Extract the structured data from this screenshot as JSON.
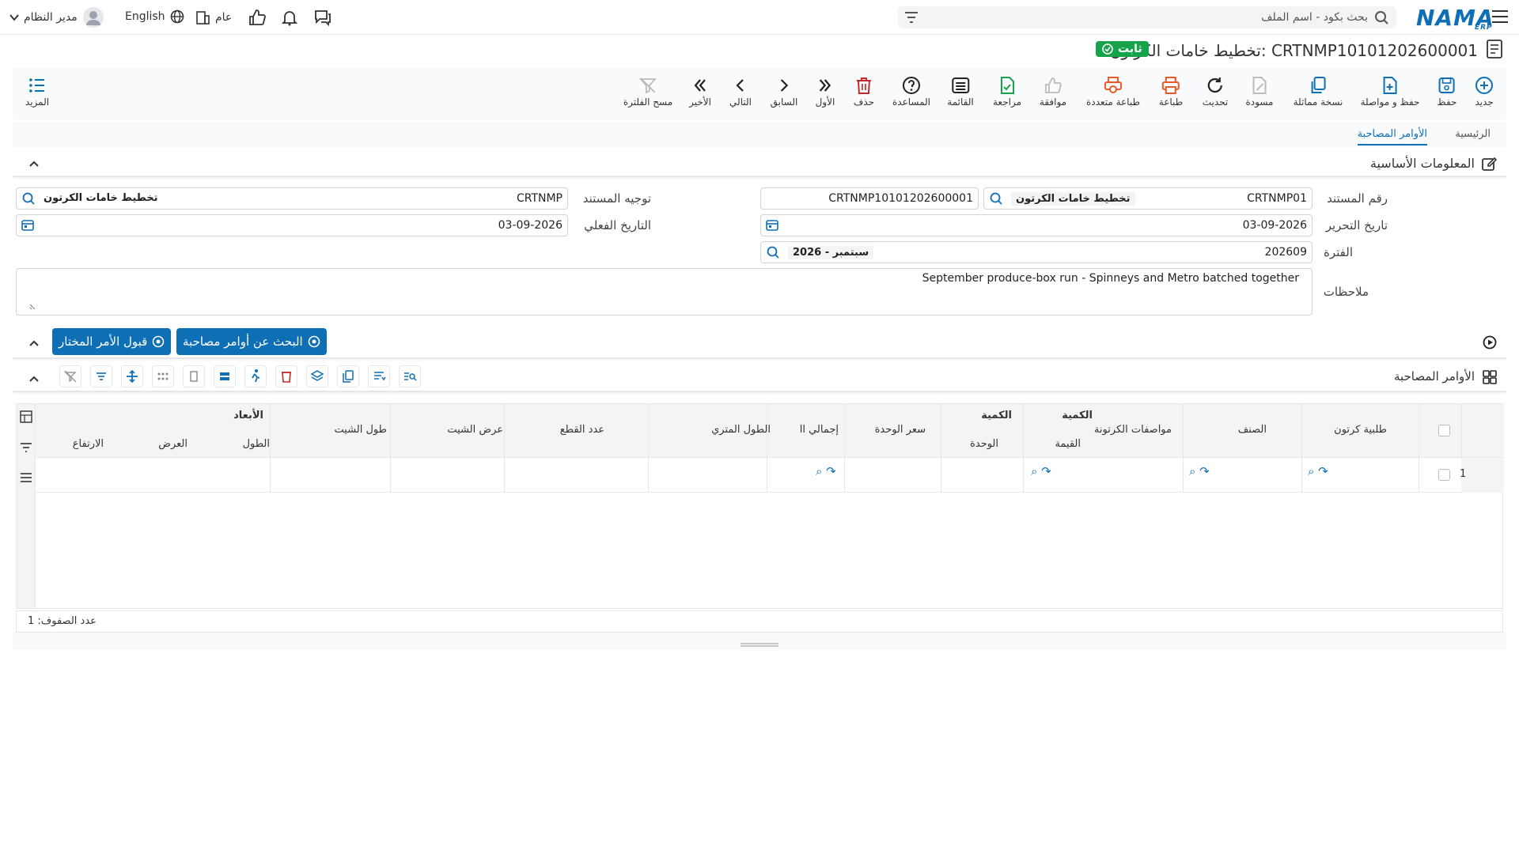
{
  "topbar": {
    "search_placeholder": "بحث بكود - اسم الملف",
    "logo": "NAMA",
    "logo_sub": "ERP",
    "user": "مدير النظام",
    "language": "English",
    "scope": "عام"
  },
  "page": {
    "title": "تخطيط خامات الكرتون: CRTNMP10101202600001",
    "status": "ثابت"
  },
  "toolbar": {
    "new": "جديد",
    "save": "حفظ",
    "save_continue": "حفظ و مواصلة",
    "duplicate": "نسخة مماثلة",
    "draft": "مسودة",
    "refresh": "تحديث",
    "print": "طباعة",
    "multi_print": "طباعة متعددة",
    "approve": "موافقة",
    "review": "مراجعة",
    "list": "القائمة",
    "help": "المساعدة",
    "delete": "حذف",
    "first": "الأول",
    "previous": "السابق",
    "next": "التالي",
    "last": "الأخير",
    "clear_filter": "مسح الفلترة",
    "more": "المزيد"
  },
  "tabs": [
    "الرئيسية",
    "الأوامر المصاحبة"
  ],
  "basic_info": {
    "title": "المعلومات الأساسية",
    "doc_number_label": "رقم المستند",
    "doc_number_code": "CRTNMP01",
    "doc_number_type": "تخطيط خامات الكرتون",
    "doc_number_value": "CRTNMP10101202600001",
    "doc_direction_label": "توجيه المستند",
    "doc_direction_code": "CRTNMP",
    "doc_direction_name": "تخطيط خامات الكرتون",
    "edit_date_label": "تاريخ التحرير",
    "edit_date": "03-09-2026",
    "actual_date_label": "التاريخ الفعلي",
    "actual_date": "03-09-2026",
    "period_label": "الفترة",
    "period_code": "202609",
    "period_name": "2026 - سبتمبر",
    "notes_label": "ملاحظات",
    "notes": "September produce-box run - Spinneys and Metro batched together"
  },
  "actions": {
    "search_orders": "البحث عن أوامر مصاحبة",
    "accept_order": "قبول الأمر المختار"
  },
  "grid": {
    "title": "الأوامر المصاحبة",
    "group_quantity_1": "الكمية",
    "group_quantity_2": "الكمية",
    "group_dimensions": "الأبعاد",
    "col_carton_order": "طلبية كرتون",
    "col_item": "الصنف",
    "col_carton_spec": "مواصفات الكرتونة",
    "col_value": "القيمة",
    "col_unit": "الوحدة",
    "col_unit_price": "سعر الوحدة",
    "col_total": "إجمالي اا",
    "col_meter_length": "الطول المتري",
    "col_cut_count": "عدد القطع",
    "col_sheet_width": "عرض الشيت",
    "col_sheet_length": "طول الشيت",
    "col_length": "الطول",
    "col_width": "العرض",
    "col_height": "الارتفاع",
    "row_number": "1",
    "row_count": "عدد الصفوف: 1"
  }
}
